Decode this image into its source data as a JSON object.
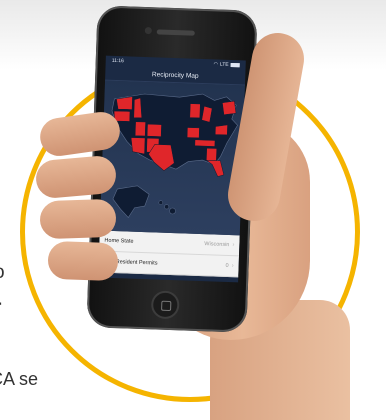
{
  "side_text": [
    "o",
    "r",
    "-",
    "CA se"
  ],
  "phone": {
    "status": {
      "time": "11:16",
      "network": "LTE"
    },
    "title": "Reciprocity Map",
    "rows": [
      {
        "label": "Home State",
        "value": "Wisconsin"
      },
      {
        "label": "Non-Resident Permits",
        "value": "0"
      }
    ]
  },
  "colors": {
    "accent_ring": "#f5b400",
    "reciprocity_state": "#e0262a",
    "other_state": "#0f1c33",
    "home_state": "#e0262a"
  }
}
